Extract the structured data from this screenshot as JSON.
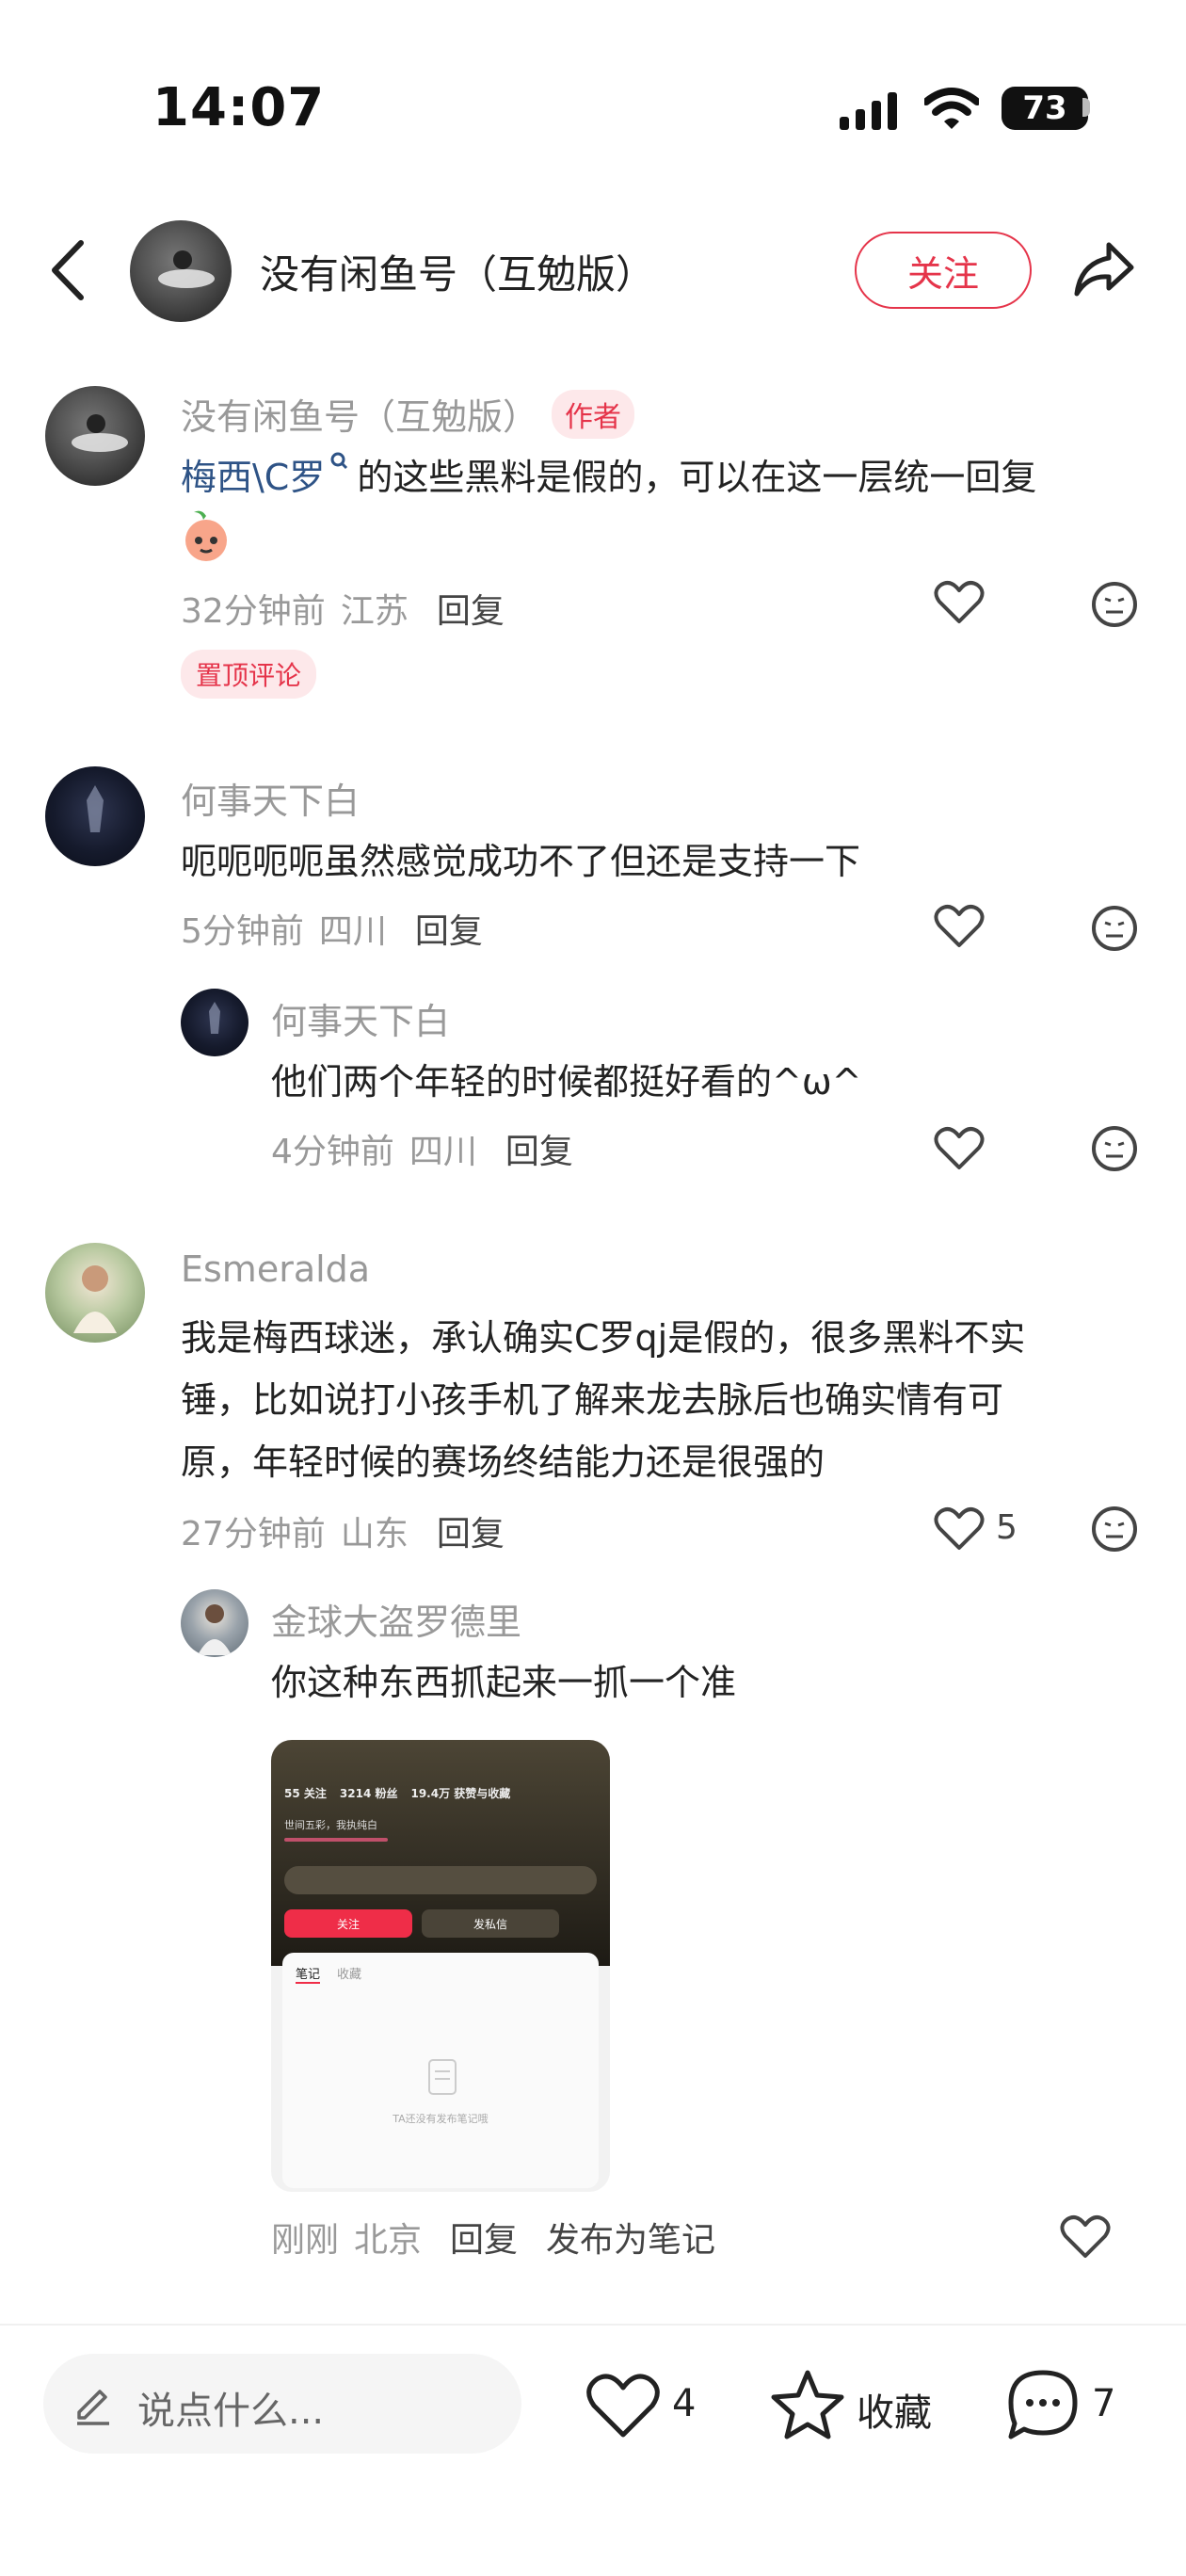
{
  "status_bar": {
    "time": "14:07",
    "battery": "73"
  },
  "header": {
    "back_label": "<",
    "title": "没有闲鱼号（互勉版）",
    "follow_label": "关注"
  },
  "comments": [
    {
      "author": "没有闲鱼号（互勉版）",
      "author_tag": "作者",
      "mention": "梅西\\C罗",
      "text": "的这些黑料是假的，可以在这一层统一回复",
      "time": "32分钟前",
      "location": "江苏",
      "reply_label": "回复",
      "pinned_label": "置顶评论"
    },
    {
      "author": "何事天下白",
      "text": "呃呃呃呃虽然感觉成功不了但还是支持一下",
      "time": "5分钟前",
      "location": "四川",
      "reply_label": "回复",
      "replies": [
        {
          "author": "何事天下白",
          "text": "他们两个年轻的时候都挺好看的^ω^",
          "time": "4分钟前",
          "location": "四川",
          "reply_label": "回复"
        }
      ]
    },
    {
      "author": "Esmeralda",
      "text_lines": [
        "我是梅西球迷，承认确实C罗qj是假的，很多黑料不实",
        "锤，比如说打小孩手机了解来龙去脉后也确实情有可",
        "原，年轻时候的赛场终结能力还是很强的"
      ],
      "time": "27分钟前",
      "location": "山东",
      "reply_label": "回复",
      "like_count": "5",
      "replies": [
        {
          "author": "金球大盗罗德里",
          "text": "你这种东西抓起来一抓一个准",
          "time": "刚刚",
          "location": "北京",
          "reply_label": "回复",
          "publish_label": "发布为笔记",
          "attachment": {
            "stats": [
              "55 关注",
              "3214 粉丝",
              "19.4万 获赞与收藏"
            ],
            "bio": "世间五彩，我执纯白",
            "follow": "关注",
            "message": "发私信",
            "tabs": [
              "笔记",
              "收藏"
            ],
            "empty_text": "TA还没有发布笔记哦"
          }
        }
      ]
    }
  ],
  "bottom_bar": {
    "input_placeholder": "说点什么...",
    "like_count": "4",
    "collect_label": "收藏",
    "comment_count": "7"
  },
  "colors": {
    "accent": "#e5344a",
    "link": "#2e5386",
    "muted": "#999999"
  }
}
